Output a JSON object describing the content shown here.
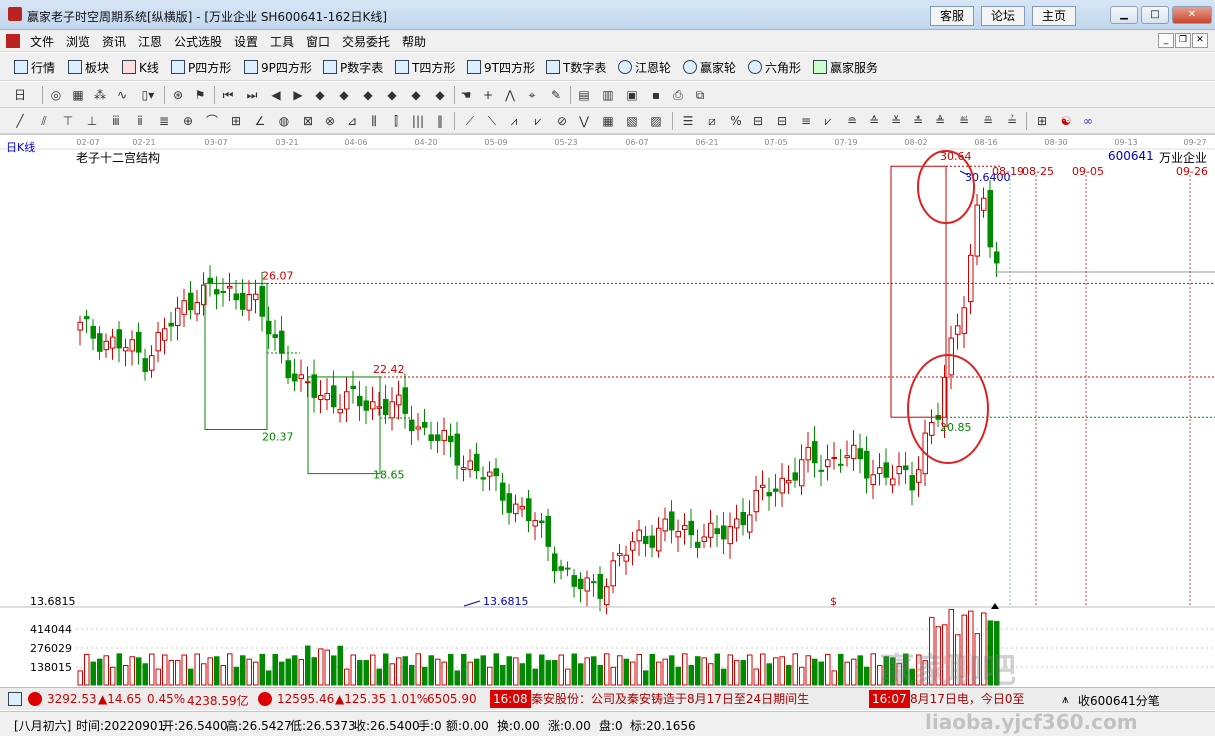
{
  "window": {
    "title": "赢家老子时空周期系统[纵横版] - [万业企业  SH600641-162日K线]",
    "links": [
      "客服",
      "论坛",
      "主页"
    ]
  },
  "menu": [
    "文件",
    "浏览",
    "资讯",
    "江恩",
    "公式选股",
    "设置",
    "工具",
    "窗口",
    "交易委托",
    "帮助"
  ],
  "toolbar1": [
    "行情",
    "板块",
    "K线",
    "P四方形",
    "9P四方形",
    "P数字表",
    "T四方形",
    "9T四方形",
    "T数字表",
    "江恩轮",
    "赢家轮",
    "六角形",
    "赢家服务"
  ],
  "chart": {
    "period_label": "日K线",
    "formula_name": "老子十二宫结构",
    "stock_code": "600641",
    "stock_name": "万业企业",
    "top_dates": [
      "02-07",
      "02-21",
      "03-07",
      "03-21",
      "04-06",
      "04-20",
      "05-09",
      "05-23",
      "06-07",
      "06-21",
      "07-05",
      "07-19",
      "08-02",
      "08-16",
      "08-30",
      "09-13",
      "09-27"
    ],
    "cycle_dates": [
      "08-19",
      "08-25",
      "09-05",
      "09-26"
    ],
    "levels": {
      "high1": "26.07",
      "low1": "20.37",
      "high2": "22.42",
      "low2": "18.65",
      "peak": "30.64",
      "peak_line": "30.6400",
      "support": "20.85",
      "low_price": "13.6815",
      "axis_low": "13.6815"
    },
    "vol_axis": [
      "414044",
      "276029",
      "138015"
    ],
    "dollar": "$"
  },
  "status": {
    "idx1": {
      "value": "3292.53",
      "change": "▲14.65",
      "pct": "0.45%",
      "amount": "4238.59亿"
    },
    "idx2": {
      "value": "12595.46",
      "change": "▲125.35",
      "pct": "1.01%",
      "amount": "6505.90"
    },
    "news1": {
      "time": "16:08",
      "text": "秦安股份：公司及秦安铸造于8月17日至24日期间生"
    },
    "news2": {
      "time": "16:07",
      "text": "8月17日电，今日0至"
    },
    "ticker": "收600641分笔"
  },
  "bottom": {
    "lunar": "[八月初六]",
    "time": "时间:20220901",
    "open": "开:26.5400",
    "high": "高:26.5427",
    "low": "低:26.5373",
    "close": "收:26.5400",
    "hand": "手:0",
    "amount": "额:0.00",
    "change": "换:0.00",
    "rise": "涨:0.00",
    "plate": "盘:0",
    "mark": "标:20.1656"
  },
  "watermark": {
    "main": "赢家聊吧",
    "url": "liaoba.yjcf360.com"
  },
  "colors": {
    "up": "#d40000",
    "down": "#008a00",
    "level_red": "#cc0000",
    "level_green": "#008a00",
    "cycle_blue": "#7aaedc"
  }
}
